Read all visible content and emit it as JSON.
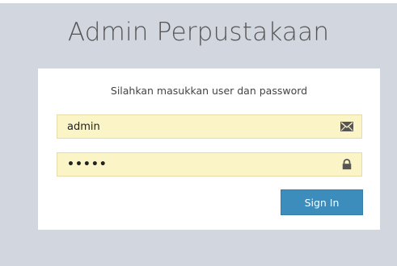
{
  "header": {
    "title": "Admin Perpustakaan"
  },
  "login": {
    "subtitle": "Silahkan masukkan user dan password",
    "username_value": "admin",
    "username_icon": "envelope-icon",
    "password_value": "admin",
    "password_icon": "lock-icon",
    "submit_label": "Sign In"
  },
  "colors": {
    "background": "#d2d6de",
    "field_autofill": "#fbf4c6",
    "button": "#3c8dbc"
  }
}
